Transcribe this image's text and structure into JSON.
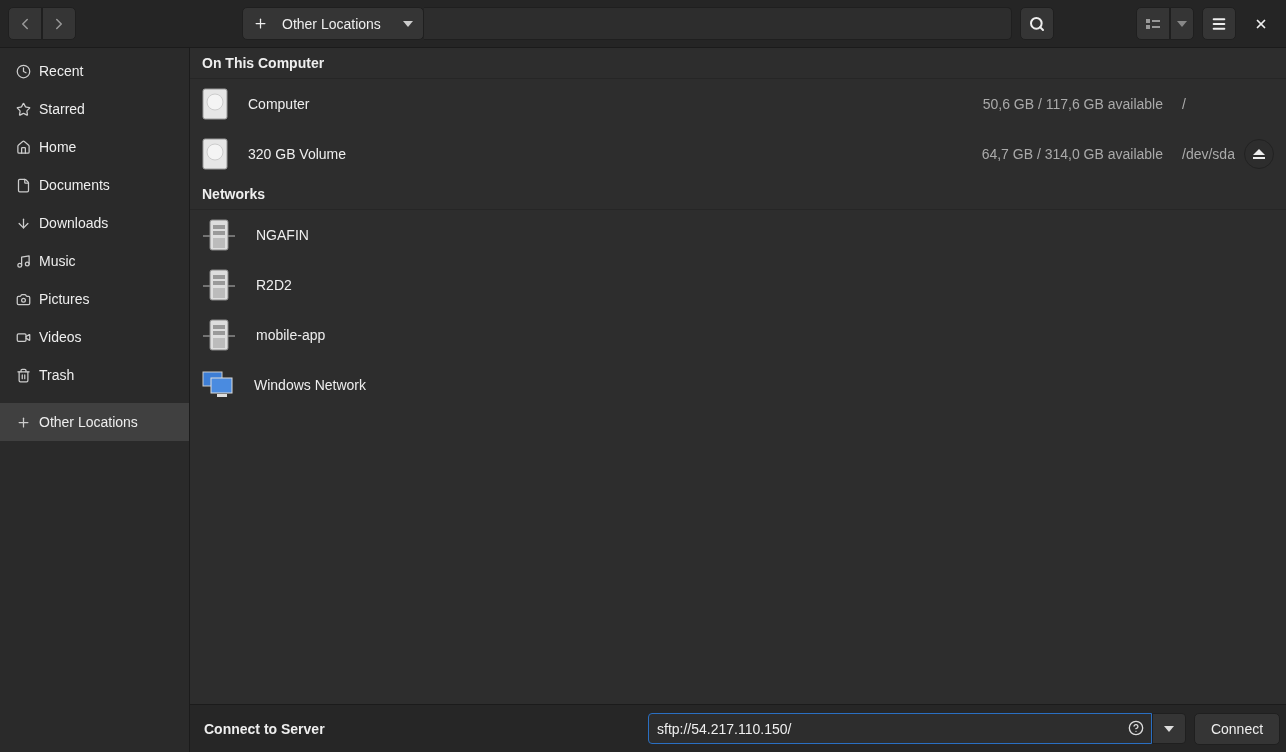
{
  "header": {
    "path_label": "Other Locations"
  },
  "sidebar": {
    "items": [
      {
        "label": "Recent",
        "selected": false
      },
      {
        "label": "Starred",
        "selected": false
      },
      {
        "label": "Home",
        "selected": false
      },
      {
        "label": "Documents",
        "selected": false
      },
      {
        "label": "Downloads",
        "selected": false
      },
      {
        "label": "Music",
        "selected": false
      },
      {
        "label": "Pictures",
        "selected": false
      },
      {
        "label": "Videos",
        "selected": false
      },
      {
        "label": "Trash",
        "selected": false
      },
      {
        "label": "Other Locations",
        "selected": true
      }
    ]
  },
  "sections": [
    {
      "title": "On This Computer",
      "items": [
        {
          "kind": "drive",
          "name": "Computer",
          "space": "50,6 GB / 117,6 GB available",
          "path": "/",
          "ejectable": false
        },
        {
          "kind": "drive",
          "name": "320 GB Volume",
          "space": "64,7 GB / 314,0 GB available",
          "path": "/dev/sda",
          "ejectable": true
        }
      ]
    },
    {
      "title": "Networks",
      "items": [
        {
          "kind": "server",
          "name": "NGAFIN"
        },
        {
          "kind": "server",
          "name": "R2D2"
        },
        {
          "kind": "server",
          "name": "mobile-app"
        },
        {
          "kind": "network",
          "name": "Windows Network"
        }
      ]
    }
  ],
  "connect": {
    "label": "Connect to Server",
    "address": "sftp://54.217.110.150/",
    "button": "Connect"
  }
}
